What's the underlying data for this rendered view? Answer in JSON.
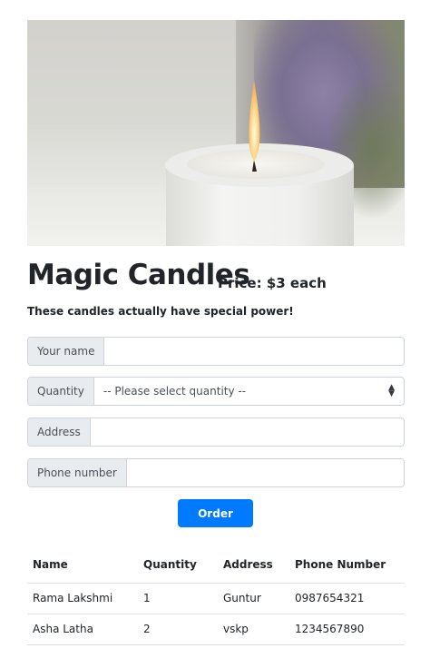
{
  "hero": {
    "image_alt": "white pillar candle with lit flame"
  },
  "product": {
    "title": "Magic Candles",
    "price": "Price: $3 each",
    "tagline": "These candles actually have special power!"
  },
  "form": {
    "name_label": "Your name",
    "name_value": "",
    "quantity_label": "Quantity",
    "quantity_selected": "-- Please select quantity --",
    "address_label": "Address",
    "address_value": "",
    "phone_label": "Phone number",
    "phone_value": "",
    "order_label": "Order"
  },
  "orders": {
    "headers": [
      "Name",
      "Quantity",
      "Address",
      "Phone Number"
    ],
    "rows": [
      [
        "Rama Lakshmi",
        "1",
        "Guntur",
        "0987654321"
      ],
      [
        "Asha Latha",
        "2",
        "vskp",
        "1234567890"
      ]
    ]
  },
  "colors": {
    "accent": "#007bff",
    "addon_bg": "#e9ecef",
    "border": "#ced4da"
  },
  "icons": {
    "select_caret": "up-down-caret-icon"
  }
}
